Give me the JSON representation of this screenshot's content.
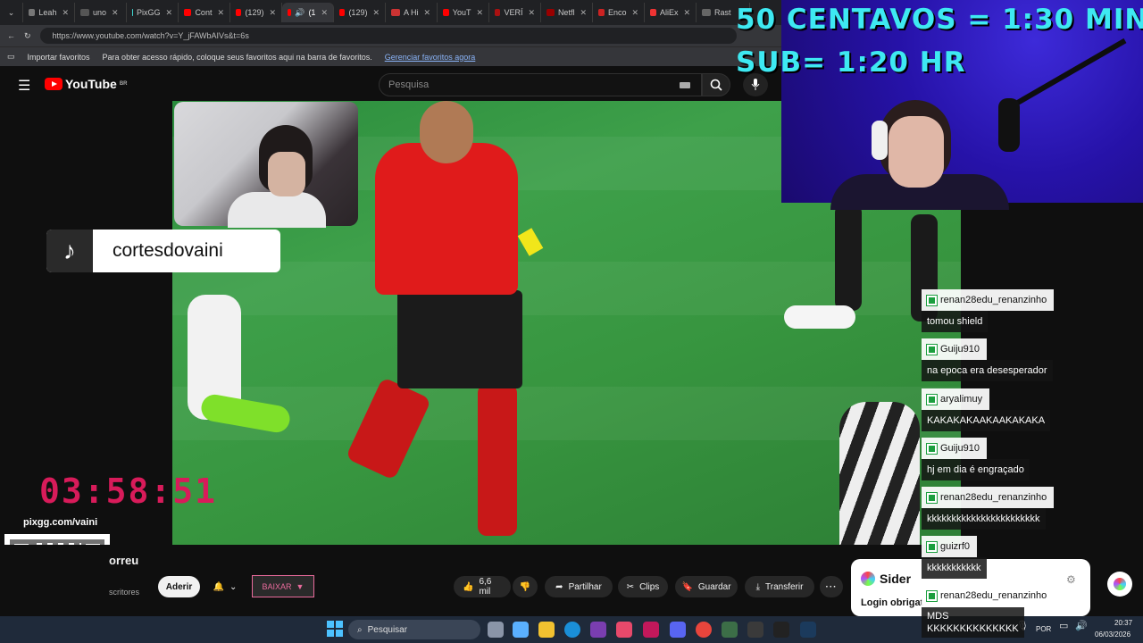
{
  "browser": {
    "tabs": [
      {
        "label": "Leah",
        "active": false
      },
      {
        "label": "uno",
        "active": false
      },
      {
        "label": "PixGG",
        "active": false
      },
      {
        "label": "Cont",
        "active": false
      },
      {
        "label": "(129)",
        "active": false
      },
      {
        "label": "(1",
        "active": true
      },
      {
        "label": "(129)",
        "active": false
      },
      {
        "label": "A Hi",
        "active": false
      },
      {
        "label": "YouT",
        "active": false
      },
      {
        "label": "VERÍ",
        "active": false
      },
      {
        "label": "Netfl",
        "active": false
      },
      {
        "label": "Enco",
        "active": false
      },
      {
        "label": "AliEx",
        "active": false
      },
      {
        "label": "Rast",
        "active": false
      }
    ],
    "url": "https://www.youtube.com/watch?v=Y_jFAWbAIVs&t=6s",
    "bookmarks_label": "Importar favoritos",
    "bookmarks_hint": "Para obter acesso rápido, coloque seus favoritos aqui na barra de favoritos.",
    "bookmarks_link": "Gerenciar favoritos agora"
  },
  "youtube": {
    "logo_text": "YouTube",
    "region": "BR",
    "search_placeholder": "Pesquisa",
    "video_title_fragment": "orreu",
    "subscribers_fragment": "scritores",
    "join_label": "Aderir",
    "download_label": "BAIXAR",
    "like_count": "6,6 mil",
    "share_label": "Partilhar",
    "clips_label": "Clips",
    "save_label": "Guardar",
    "transfer_label": "Transferir"
  },
  "stream_overlay": {
    "donation_line": "50 CENTAVOS = 1:30 MIN",
    "sub_line": "SUB= 1:20 HR",
    "tiktok_handle": "cortesdovaini",
    "timer": "03:58:51",
    "pix_url": "pixgg.com/vaini"
  },
  "chat": [
    {
      "user": "renan28edu_renanzinho",
      "message": "tomou shield"
    },
    {
      "user": "Guiju910",
      "message": "na epoca era desesperador"
    },
    {
      "user": "aryalimuy",
      "message": "KAKAKAKAAKAAKAKAKA"
    },
    {
      "user": "Guiju910",
      "message": "hj em dia é engraçado"
    },
    {
      "user": "renan28edu_renanzinho",
      "message": "kkkkkkkkkkkkkkkkkkkkkkk"
    },
    {
      "user": "guizrf0",
      "message": "kkkkkkkkkkk"
    },
    {
      "user": "renan28edu_renanzinho",
      "message": "MDS\nKKKKKKKKKKKKKK"
    }
  ],
  "sider": {
    "title": "Sider",
    "subtitle": "Login obrigat"
  },
  "taskbar": {
    "search_label": "Pesquisar",
    "language": "POR",
    "time": "20:37",
    "date": "06/03/2026"
  },
  "colors": {
    "overlay_cyan": "#3ee9f2",
    "timer_pink": "#d81b5a",
    "youtube_red": "#ff0000",
    "chat_badge_green": "#1b9e3e"
  }
}
